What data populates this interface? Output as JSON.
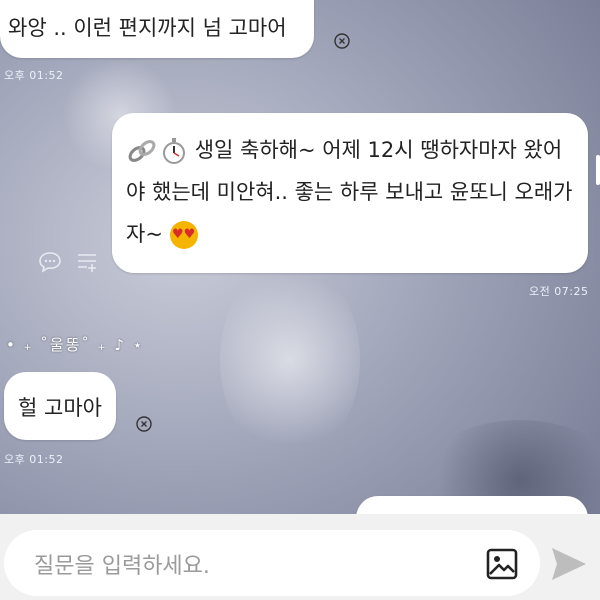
{
  "messages": [
    {
      "text": "와앙 .. 이런 편지까지 넘 고마어",
      "time": "오후 01:52",
      "side": "left"
    },
    {
      "text": "생일 축하해~ 어제 12시 땡하자마자 왔어야 했는데 미안혀.. 좋는 하루 보내고 윤또니 오래가자~",
      "time": "오전 07:25",
      "side": "right",
      "icons": [
        "link-icon",
        "stopwatch-icon",
        "heart-eyes-cat-icon"
      ]
    },
    {
      "text": "헐 고마아",
      "time": "오후 01:52",
      "side": "left"
    }
  ],
  "sticker_text": "• ₊ ˚울똥˚ ₊ ♪ ⋆",
  "input": {
    "placeholder": "질문을 입력하세요."
  },
  "icons": {
    "dismiss": "close-circle-icon",
    "chat": "chat-bubble-icon",
    "menu": "list-add-icon",
    "image": "image-icon",
    "send": "send-icon"
  },
  "colors": {
    "bubble": "#ffffff",
    "send": "#bdbdbd",
    "timestamp": "#eef0f8"
  }
}
